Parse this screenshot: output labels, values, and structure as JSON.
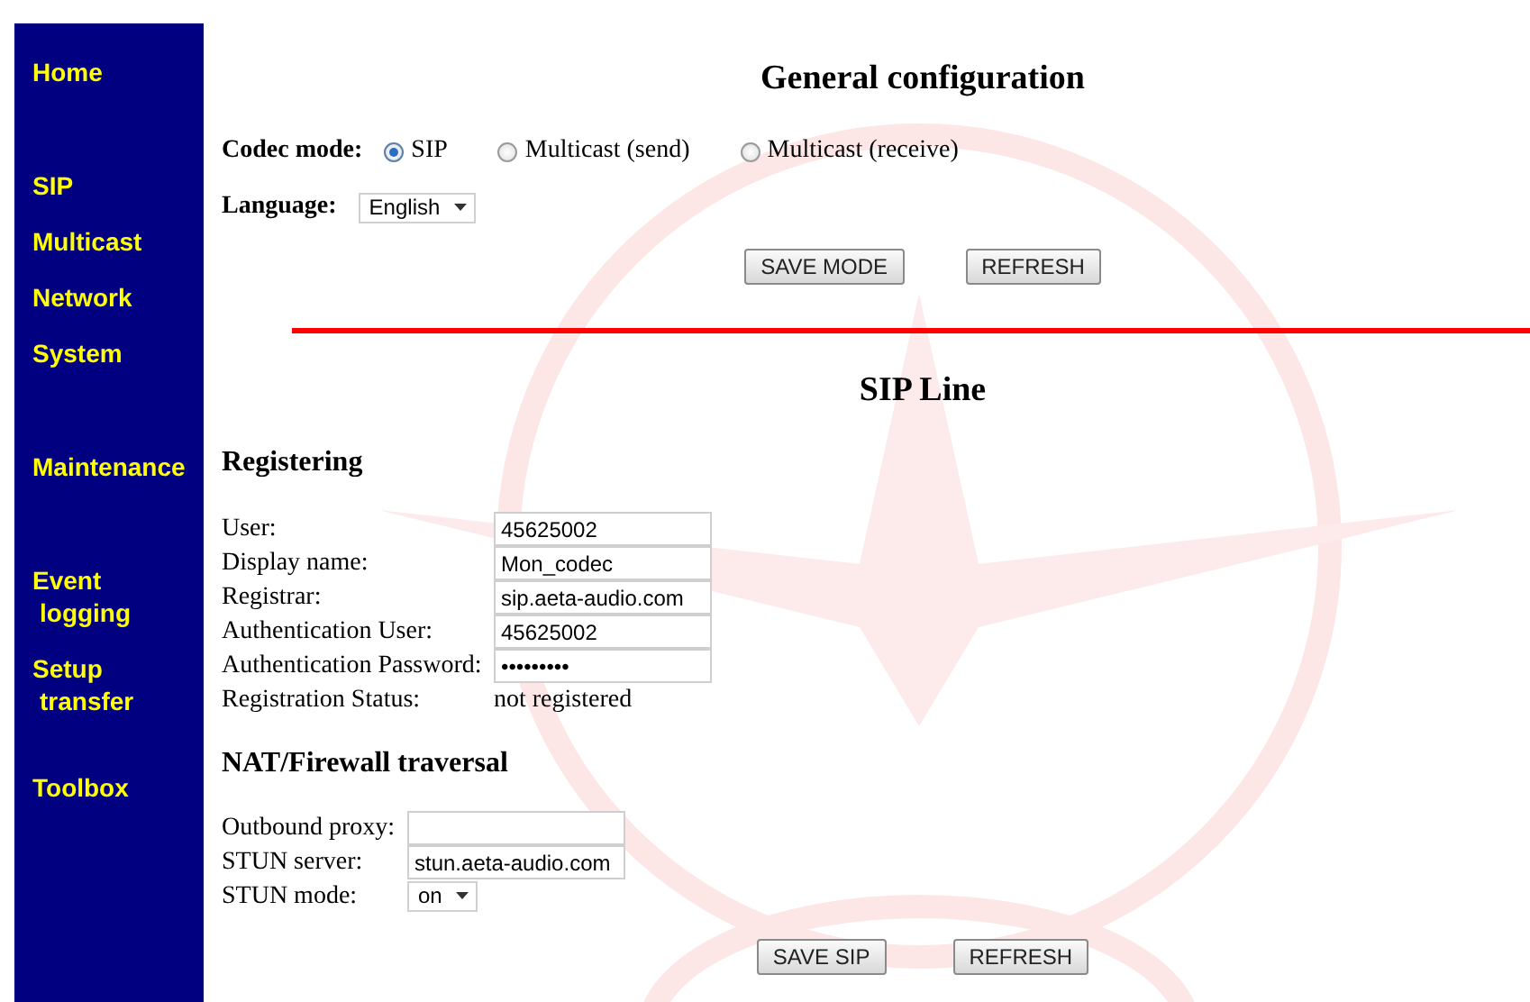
{
  "sidebar": {
    "items": [
      {
        "label": "Home"
      },
      {
        "label": "SIP"
      },
      {
        "label": "Multicast"
      },
      {
        "label": "Network"
      },
      {
        "label": "System"
      },
      {
        "label": "Maintenance"
      },
      {
        "label": "Event logging"
      },
      {
        "label": "Setup transfer"
      },
      {
        "label": "Toolbox"
      }
    ]
  },
  "general": {
    "title": "General configuration",
    "codec_mode": {
      "label": "Codec mode:",
      "options": [
        {
          "label": "SIP",
          "selected": true
        },
        {
          "label": "Multicast (send)",
          "selected": false
        },
        {
          "label": "Multicast (receive)",
          "selected": false
        }
      ]
    },
    "language": {
      "label": "Language:",
      "value": "English"
    },
    "buttons": [
      "SAVE MODE",
      "REFRESH"
    ]
  },
  "sip_line": {
    "title": "SIP Line",
    "registering": {
      "heading": "Registering",
      "fields": [
        {
          "label": "User:",
          "kind": "text",
          "value": "45625002"
        },
        {
          "label": "Display name:",
          "kind": "text",
          "value": "Mon_codec"
        },
        {
          "label": "Registrar:",
          "kind": "text",
          "value": "sip.aeta-audio.com"
        },
        {
          "label": "Authentication User:",
          "kind": "text",
          "value": "45625002"
        },
        {
          "label": "Authentication Password:",
          "kind": "text",
          "value": "•••••••••"
        },
        {
          "label": "Registration Status:",
          "kind": "static",
          "value": "not registered"
        }
      ]
    },
    "nat": {
      "heading": "NAT/Firewall traversal",
      "fields": [
        {
          "label": "Outbound proxy:",
          "kind": "text"
        },
        {
          "label": "STUN server:",
          "kind": "text",
          "value": "stun.aeta-audio.com"
        },
        {
          "label": "STUN mode:",
          "kind": "select",
          "value": "on"
        }
      ]
    },
    "buttons": [
      "SAVE SIP",
      "REFRESH"
    ]
  }
}
